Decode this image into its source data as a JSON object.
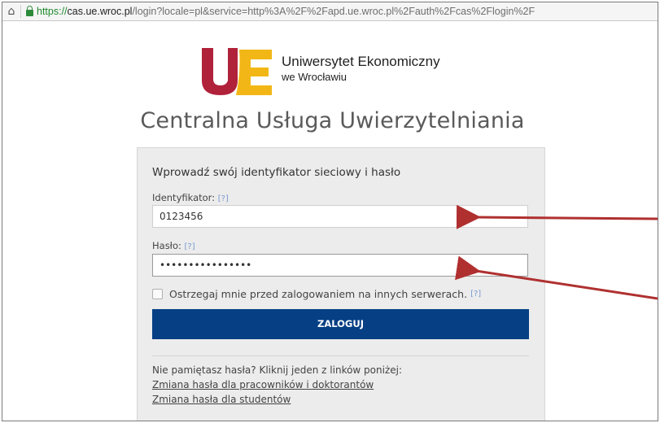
{
  "browser": {
    "url_https": "https://",
    "url_host": "cas.ue.wroc.pl",
    "url_path": "/login?locale=pl&service=http%3A%2F%2Fapd.ue.wroc.pl%2Fauth%2Fcas%2Flogin%2F",
    "home_icon": "home-icon",
    "lock_icon": "lock-icon"
  },
  "brand": {
    "name": "Uniwersytet Ekonomiczny",
    "sub": "we Wrocławiu",
    "colors": {
      "u": "#b0223a",
      "e": "#f2b716"
    }
  },
  "page_title": "Centralna Usługa Uwierzytelniania",
  "form": {
    "heading": "Wprowadź swój identyfikator sieciowy i hasło",
    "id_label": "Identyfikator:",
    "id_hint": "[?]",
    "id_value": "0123456",
    "pw_label": "Hasło:",
    "pw_hint": "[?]",
    "pw_value": "••••••••••••••••",
    "warn_label": "Ostrzegaj mnie przed zalogowaniem na innych serwerach.",
    "warn_hint": "[?]",
    "submit": "ZALOGUJ",
    "button_color": "#063f84"
  },
  "help": {
    "forgot": "Nie pamiętasz hasła? Kliknij jeden z linków poniżej:",
    "link_staff": "Zmiana hasła dla pracowników i doktorantów",
    "link_students": "Zmiana hasła dla studentów"
  },
  "annotation_color": "#b03030"
}
